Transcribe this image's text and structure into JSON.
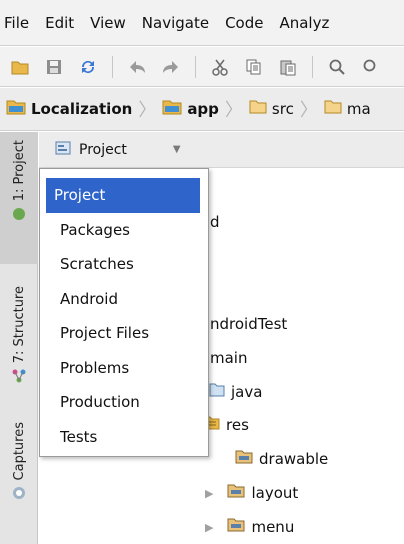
{
  "menubar": {
    "items": [
      {
        "label": "File"
      },
      {
        "label": "Edit"
      },
      {
        "label": "View"
      },
      {
        "label": "Navigate"
      },
      {
        "label": "Code"
      },
      {
        "label": "Analyz"
      }
    ]
  },
  "toolbar": {
    "icons": [
      "open-folder-icon",
      "save-icon",
      "sync-icon",
      "undo-icon",
      "redo-icon",
      "cut-icon",
      "copy-icon",
      "paste-icon",
      "find-icon"
    ]
  },
  "breadcrumb": {
    "items": [
      {
        "label": "Localization"
      },
      {
        "label": "app"
      },
      {
        "label": "src"
      },
      {
        "label": "ma"
      }
    ]
  },
  "left_strip": {
    "project_tab": "1: Project",
    "structure_tab": "7: Structure",
    "captures_tab": "Captures"
  },
  "project_panel": {
    "view_label": "Project"
  },
  "view_menu": {
    "items": [
      {
        "label": "Project",
        "selected": true
      },
      {
        "label": "Packages"
      },
      {
        "label": "Scratches"
      },
      {
        "label": "Android"
      },
      {
        "label": "Project Files"
      },
      {
        "label": "Problems"
      },
      {
        "label": "Production"
      },
      {
        "label": "Tests"
      }
    ]
  },
  "tree": {
    "partial_d": "d",
    "android_test": "ndroidTest",
    "main": "main",
    "java": "java",
    "res": "res",
    "drawable": "drawable",
    "layout": "layout",
    "menu": "menu"
  },
  "colors": {
    "selection": "#2f65ca",
    "folder": "#e8b84a"
  }
}
